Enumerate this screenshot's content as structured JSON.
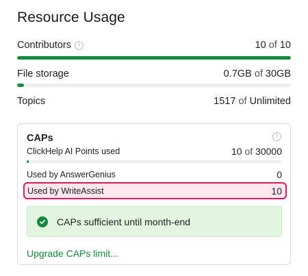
{
  "title": "Resource Usage",
  "contributors": {
    "label": "Contributors",
    "value": "10",
    "of": "of",
    "limit": "10",
    "fill": 1.0
  },
  "file_storage": {
    "label": "File storage",
    "value": "0.7GB",
    "of": "of",
    "limit": "30GB",
    "fill": 0.025
  },
  "topics": {
    "label": "Topics",
    "value": "1517",
    "of": "of",
    "limit": "Unlimited"
  },
  "caps": {
    "title": "CAPs",
    "ai_points": {
      "label": "ClickHelp AI Points used",
      "value": "10",
      "of": "of",
      "limit": "30000",
      "fill": 0.005
    },
    "answer_genius": {
      "label": "Used by AnswerGenius",
      "value": "0"
    },
    "write_assist": {
      "label": "Used by WriteAssist",
      "value": "10"
    },
    "status_text": "CAPs sufficient until month-end",
    "upgrade_link": "Upgrade CAPs limit..."
  },
  "colors": {
    "accent": "#138a3c",
    "highlight_border": "#d81b60",
    "highlight_bg": "#fde7ee",
    "status_bg": "#e3f5e1"
  }
}
